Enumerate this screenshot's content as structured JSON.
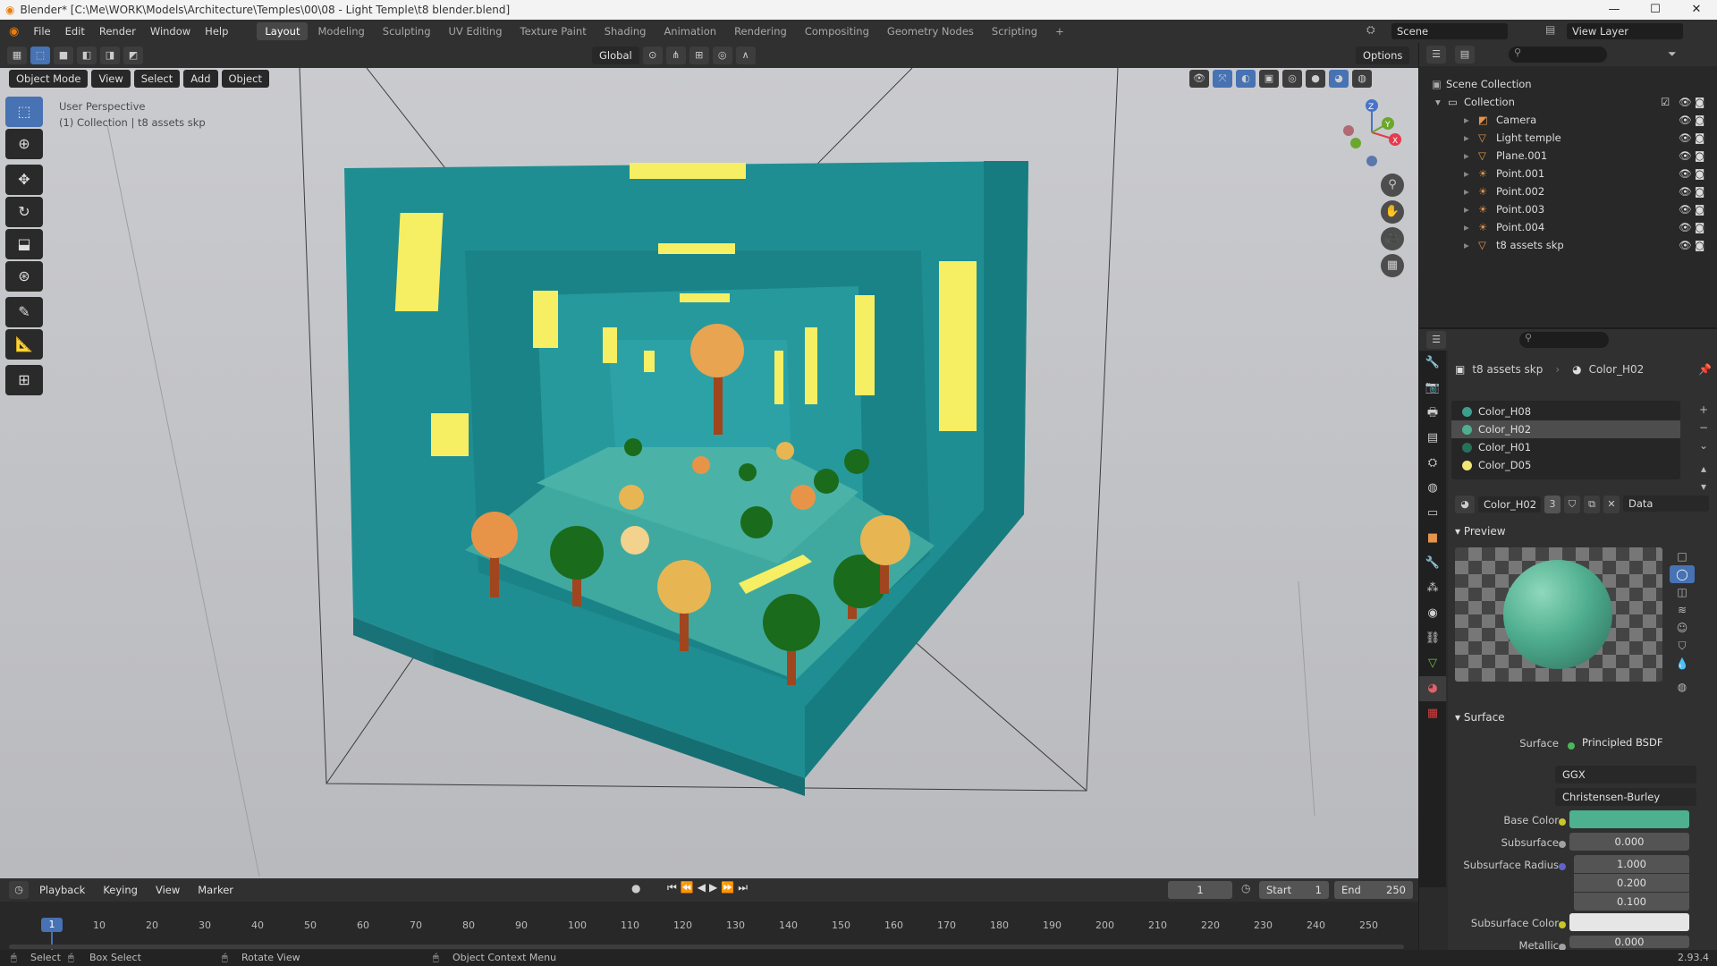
{
  "window": {
    "title": "Blender* [C:\\Me\\WORK\\Models\\Architecture\\Temples\\00\\08 - Light Temple\\t8 blender.blend]",
    "minimize": "—",
    "maximize": "☐",
    "close": "✕"
  },
  "menu": {
    "items": [
      "File",
      "Edit",
      "Render",
      "Window",
      "Help"
    ],
    "workspaces": [
      "Layout",
      "Modeling",
      "Sculpting",
      "UV Editing",
      "Texture Paint",
      "Shading",
      "Animation",
      "Rendering",
      "Compositing",
      "Geometry Nodes",
      "Scripting"
    ],
    "active_workspace": "Layout",
    "add": "+",
    "scene": "Scene",
    "view_layer": "View Layer"
  },
  "viewport": {
    "mode": "Object Mode",
    "menus": [
      "View",
      "Select",
      "Add",
      "Object"
    ],
    "transform_orientation": "Global",
    "options": "Options",
    "overlay_line1": "User Perspective",
    "overlay_line2": "(1) Collection | t8 assets skp",
    "gizmo_axes": [
      "X",
      "Y",
      "Z"
    ]
  },
  "outliner": {
    "root": "Scene Collection",
    "collection": "Collection",
    "items": [
      "Camera",
      "Light temple",
      "Plane.001",
      "Point.001",
      "Point.002",
      "Point.003",
      "Point.004",
      "t8 assets skp"
    ]
  },
  "properties": {
    "object": "t8 assets skp",
    "material": "Color_H02",
    "slots": [
      {
        "name": "Color_H08",
        "color": "#3d9e8d"
      },
      {
        "name": "Color_H02",
        "color": "#4fae8f"
      },
      {
        "name": "Color_H01",
        "color": "#27705c"
      },
      {
        "name": "Color_D05",
        "color": "#f1e677"
      }
    ],
    "selected_slot": "Color_H02",
    "material_users": "3",
    "link": "Data",
    "preview_label": "Preview",
    "surface_label": "Surface",
    "surface_field_label": "Surface",
    "surface_shader": "Principled BSDF",
    "distribution": "GGX",
    "subsurface_method": "Christensen-Burley",
    "fields": {
      "base_color_label": "Base Color",
      "base_color": "#4db08e",
      "subsurface_label": "Subsurface",
      "subsurface": "0.000",
      "subsurface_radius_label": "Subsurface Radius",
      "radius": [
        "1.000",
        "0.200",
        "0.100"
      ],
      "subsurface_color_label": "Subsurface Color",
      "subsurface_color": "#e6e6e6",
      "metallic_label": "Metallic",
      "metallic": "0.000"
    }
  },
  "timeline": {
    "menus": [
      "Playback",
      "Keying",
      "View",
      "Marker"
    ],
    "current_frame": "1",
    "start_label": "Start",
    "start": "1",
    "end_label": "End",
    "end": "250",
    "ticks": [
      "10",
      "20",
      "30",
      "40",
      "50",
      "60",
      "70",
      "80",
      "90",
      "100",
      "110",
      "120",
      "130",
      "140",
      "150",
      "160",
      "170",
      "180",
      "190",
      "200",
      "210",
      "220",
      "230",
      "240",
      "250"
    ],
    "playhead": "1"
  },
  "status": {
    "select": "Select",
    "box_select": "Box Select",
    "rotate": "Rotate View",
    "context": "Object Context Menu",
    "version": "2.93.4"
  }
}
